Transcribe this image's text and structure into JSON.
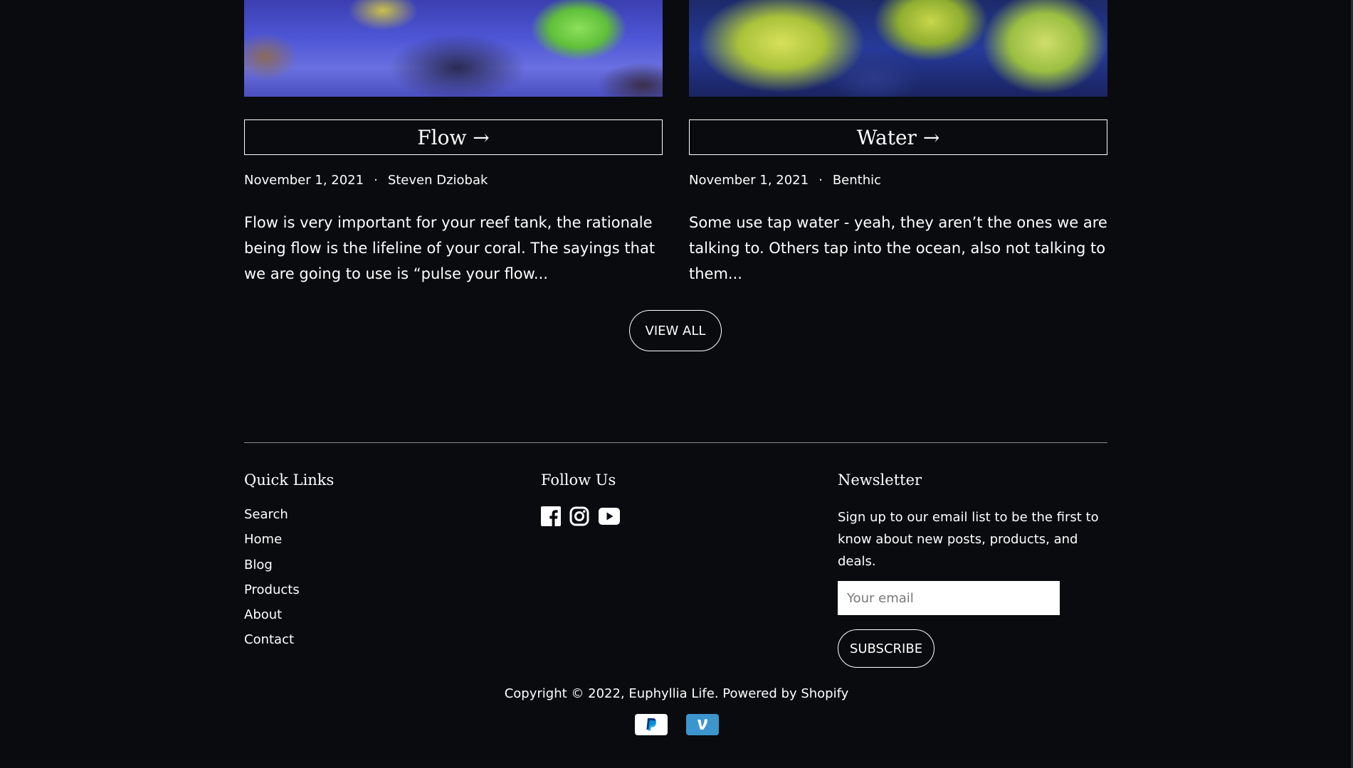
{
  "articles": [
    {
      "title": "Flow →",
      "date": "November 1, 2021",
      "separator": "·",
      "author": "Steven Dziobak",
      "excerpt": "Flow is very important for your reef tank, the rationale being flow is the lifeline of your coral. The sayings that we are going to use is “pulse your flow..."
    },
    {
      "title": "Water →",
      "date": "November 1, 2021",
      "separator": "·",
      "author": "Benthic",
      "excerpt": "Some use tap water - yeah, they aren’t the ones we are talking to. Others tap into the ocean, also not talking to them..."
    }
  ],
  "view_all_label": "VIEW ALL",
  "footer": {
    "quick_links": {
      "heading": "Quick Links",
      "items": [
        "Search",
        "Home",
        "Blog",
        "Products",
        "About",
        "Contact"
      ]
    },
    "follow_us": {
      "heading": "Follow Us",
      "icons": [
        "facebook-icon",
        "instagram-icon",
        "youtube-icon"
      ]
    },
    "newsletter": {
      "heading": "Newsletter",
      "text": "Sign up to our email list to be the first to know about new posts, products, and deals.",
      "email_placeholder": "Your email",
      "subscribe_label": "SUBSCRIBE"
    },
    "copyright": "Copyright © 2022, Euphyllia Life. Powered by Shopify",
    "payments": [
      "paypal-icon",
      "venmo-icon"
    ]
  },
  "colors": {
    "background": "#0a0b0e",
    "text": "#ffffff",
    "divider": "#8a8a8a",
    "venmo": "#3d95ce",
    "paypal_blue": "#003087"
  }
}
